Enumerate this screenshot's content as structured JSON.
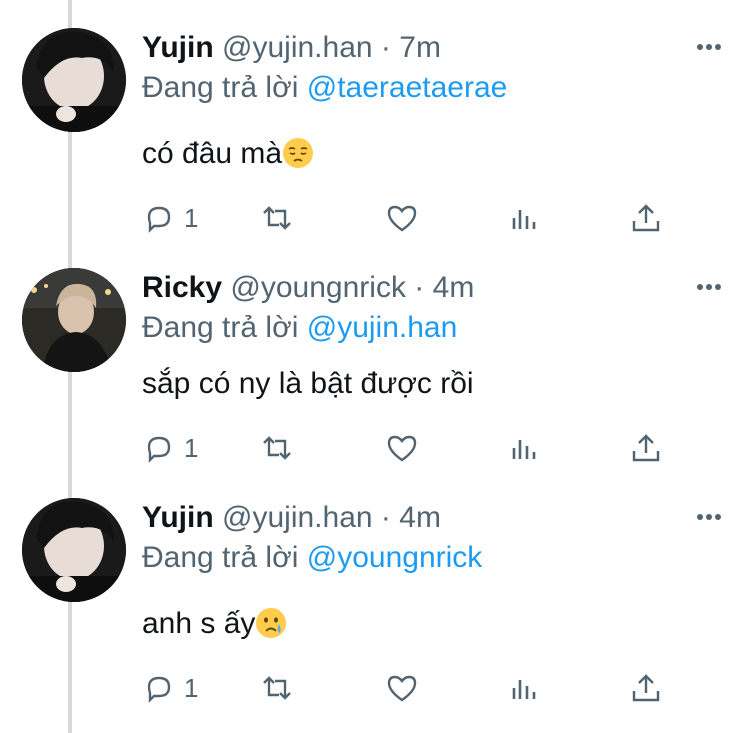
{
  "tweets": [
    {
      "name": "Yujin",
      "handle": "@yujin.han",
      "dot": "·",
      "time": "7m",
      "reply_prefix": "Đang trả lời",
      "reply_to": "@taeraetaerae",
      "text": "có đâu mà",
      "emoji": "pensive-face",
      "avatar": "yujin-avatar",
      "reply_count": "1"
    },
    {
      "name": "Ricky",
      "handle": "@youngnrick",
      "dot": "·",
      "time": "4m",
      "reply_prefix": "Đang trả lời",
      "reply_to": "@yujin.han",
      "text": "sắp có ny là bật được rồi",
      "emoji": "",
      "avatar": "ricky-avatar",
      "reply_count": "1"
    },
    {
      "name": "Yujin",
      "handle": "@yujin.han",
      "dot": "·",
      "time": "4m",
      "reply_prefix": "Đang trả lời",
      "reply_to": "@youngnrick",
      "text": "anh s ấy",
      "emoji": "crying-face",
      "avatar": "yujin-avatar",
      "reply_count": "1"
    }
  ],
  "icons": [
    "reply-icon",
    "retweet-icon",
    "like-icon",
    "analytics-icon",
    "share-icon",
    "more-icon"
  ],
  "colors": {
    "text": "#0f1419",
    "secondary": "#536471",
    "mention": "#1d9bf0",
    "thread_line": "#d6d9dc"
  }
}
